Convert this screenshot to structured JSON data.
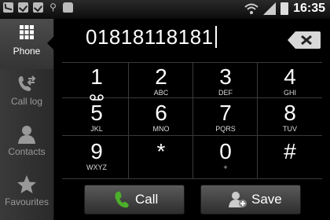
{
  "status_bar": {
    "time": "16:35",
    "icons": [
      "mail-icon",
      "check-icon",
      "check-icon",
      "usb-icon",
      "bag-icon",
      "wifi-icon",
      "signal-icon",
      "battery-icon"
    ]
  },
  "sidebar": {
    "tabs": [
      {
        "label": "Phone",
        "icon": "dialpad-icon",
        "active": true
      },
      {
        "label": "Call log",
        "icon": "call-log-icon",
        "active": false
      },
      {
        "label": "Contacts",
        "icon": "contact-icon",
        "active": false
      },
      {
        "label": "Favourites",
        "icon": "star-icon",
        "active": false
      }
    ]
  },
  "dialer": {
    "number": "01818118181",
    "keys": [
      {
        "digit": "1",
        "letters": ""
      },
      {
        "digit": "2",
        "letters": "ABC"
      },
      {
        "digit": "3",
        "letters": "DEF"
      },
      {
        "digit": "4",
        "letters": "GHI"
      },
      {
        "digit": "5",
        "letters": "JKL"
      },
      {
        "digit": "6",
        "letters": "MNO"
      },
      {
        "digit": "7",
        "letters": "PQRS"
      },
      {
        "digit": "8",
        "letters": "TUV"
      },
      {
        "digit": "9",
        "letters": "WXYZ"
      },
      {
        "digit": "*",
        "letters": ""
      },
      {
        "digit": "0",
        "letters": "+"
      },
      {
        "digit": "#",
        "letters": ""
      }
    ],
    "call_label": "Call",
    "save_label": "Save"
  },
  "colors": {
    "call_icon": "#4caf2a",
    "background": "#000000",
    "sidebar": "#343434"
  }
}
